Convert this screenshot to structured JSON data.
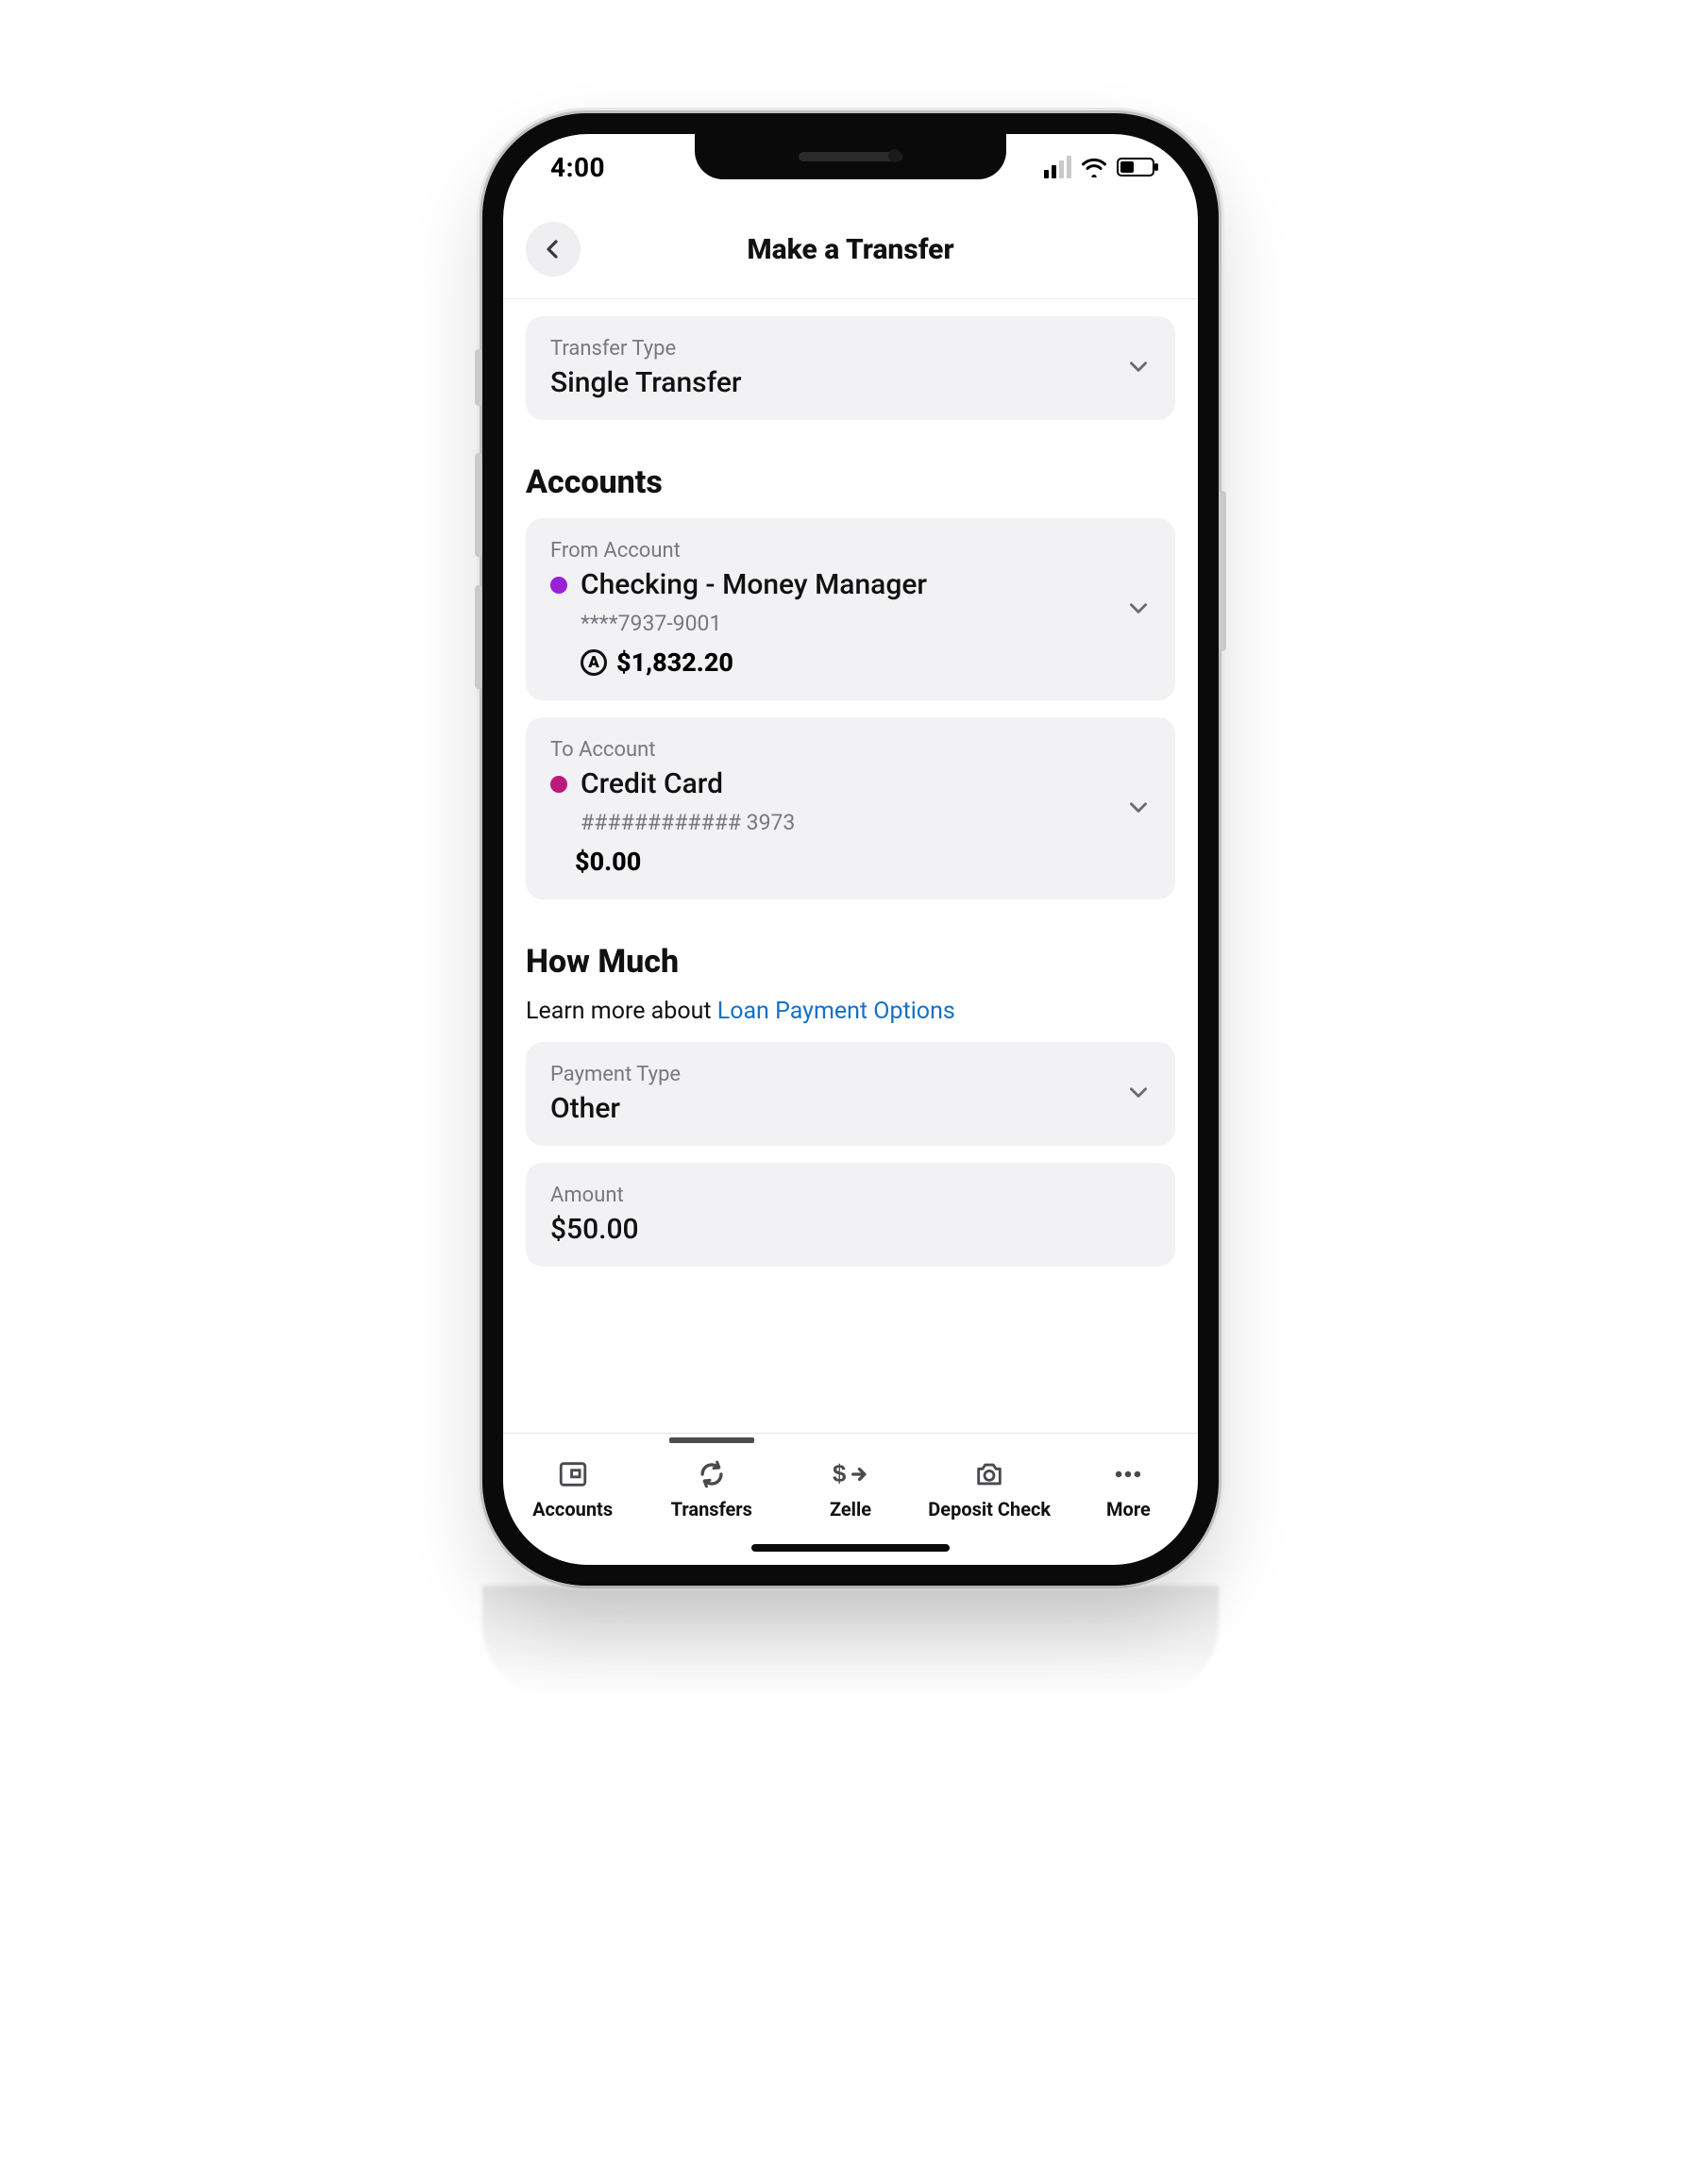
{
  "status": {
    "time": "4:00"
  },
  "nav": {
    "title": "Make a Transfer"
  },
  "transfer_type": {
    "label": "Transfer Type",
    "value": "Single Transfer"
  },
  "sections": {
    "accounts_heading": "Accounts",
    "how_much_heading": "How Much"
  },
  "from_account": {
    "label": "From Account",
    "name": "Checking - Money Manager",
    "masked": "****7937-9001",
    "balance": "$1,832.20",
    "dot_color": "#9a1fd6"
  },
  "to_account": {
    "label": "To Account",
    "name": "Credit Card",
    "masked": "############ 3973",
    "balance": "$0.00",
    "dot_color": "#bb1a7d"
  },
  "learn_more": {
    "prefix": "Learn more about ",
    "link_text": "Loan Payment Options"
  },
  "payment_type": {
    "label": "Payment Type",
    "value": "Other"
  },
  "amount": {
    "label": "Amount",
    "value": "$50.00"
  },
  "tabs": {
    "accounts": "Accounts",
    "transfers": "Transfers",
    "zelle": "Zelle",
    "deposit": "Deposit Check",
    "more": "More"
  }
}
